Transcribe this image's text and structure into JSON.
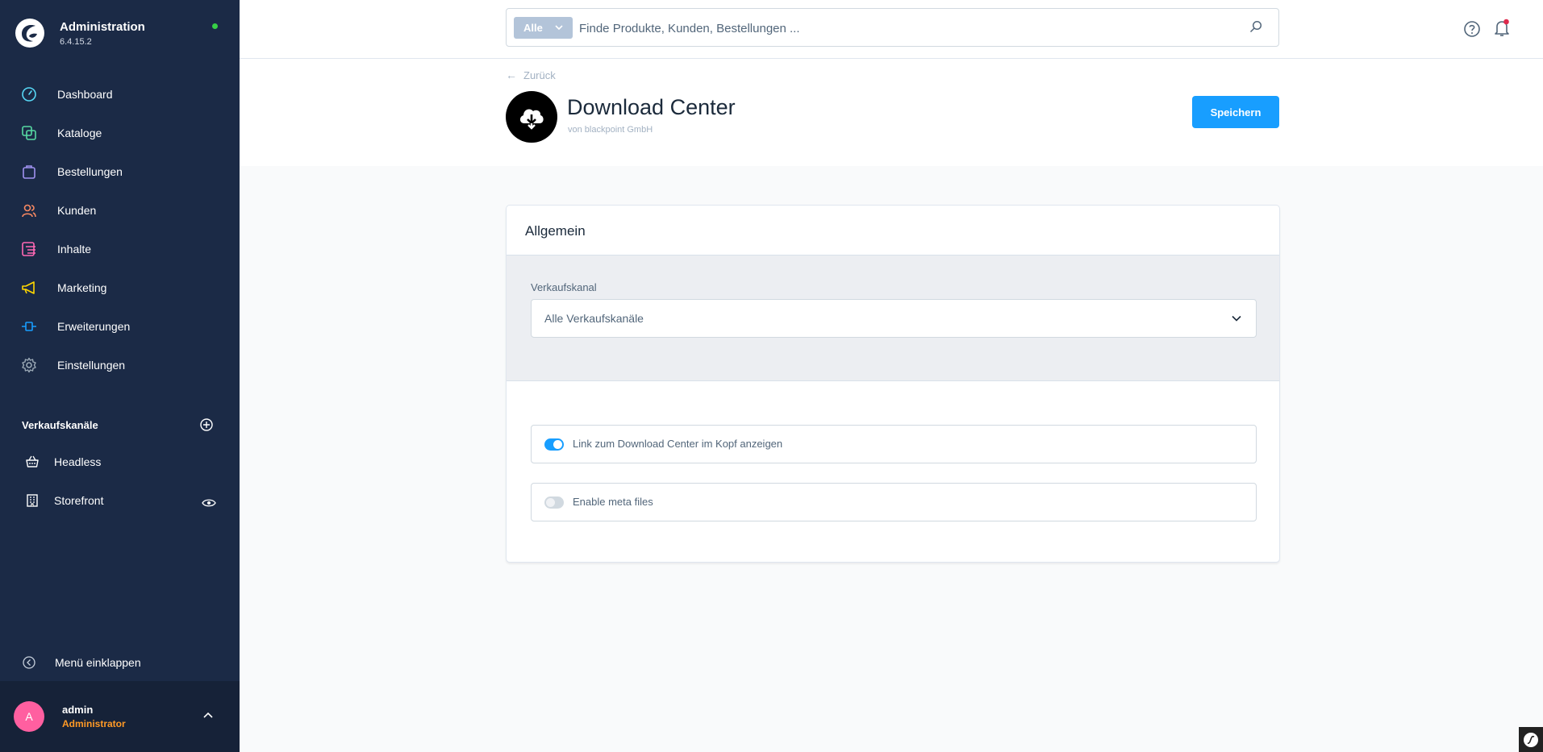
{
  "app": {
    "title": "Administration",
    "version": "6.4.15.2",
    "status_color": "#37d046"
  },
  "sidebar": {
    "items": [
      {
        "label": "Dashboard",
        "icon": "gauge-icon",
        "color": "#57d9f7"
      },
      {
        "label": "Kataloge",
        "icon": "products-icon",
        "color": "#57d9a3"
      },
      {
        "label": "Bestellungen",
        "icon": "shopping-bag-icon",
        "color": "#a092f0"
      },
      {
        "label": "Kunden",
        "icon": "users-icon",
        "color": "#f88962"
      },
      {
        "label": "Inhalte",
        "icon": "content-icon",
        "color": "#ff68b4"
      },
      {
        "label": "Marketing",
        "icon": "megaphone-icon",
        "color": "#ffd700"
      },
      {
        "label": "Erweiterungen",
        "icon": "plug-icon",
        "color": "#189eff"
      },
      {
        "label": "Einstellungen",
        "icon": "gear-icon",
        "color": "#9aa8b5"
      }
    ],
    "sales_channels_title": "Verkaufskanäle",
    "sales_channels": [
      {
        "label": "Headless",
        "icon": "basket-icon"
      },
      {
        "label": "Storefront",
        "icon": "storefront-icon"
      }
    ],
    "collapse_label": "Menü einklappen",
    "user": {
      "initial": "A",
      "name": "admin",
      "role": "Administrator"
    }
  },
  "search": {
    "type_label": "Alle",
    "placeholder": "Finde Produkte, Kunden, Bestellungen ..."
  },
  "header": {
    "back_label": "Zurück",
    "plugin_title": "Download Center",
    "plugin_vendor": "von blackpoint GmbH",
    "save_label": "Speichern"
  },
  "card": {
    "title": "Allgemein",
    "sales_channel_label": "Verkaufskanal",
    "sales_channel_value": "Alle Verkaufskanäle",
    "switches": [
      {
        "label": "Link zum Download Center im Kopf anzeigen",
        "on": true
      },
      {
        "label": "Enable meta files",
        "on": false
      }
    ]
  },
  "colors": {
    "sidebar_bg": "#1b2a46",
    "primary": "#189eff",
    "role": "#ff9a26",
    "avatar": "#ff5fa0"
  }
}
